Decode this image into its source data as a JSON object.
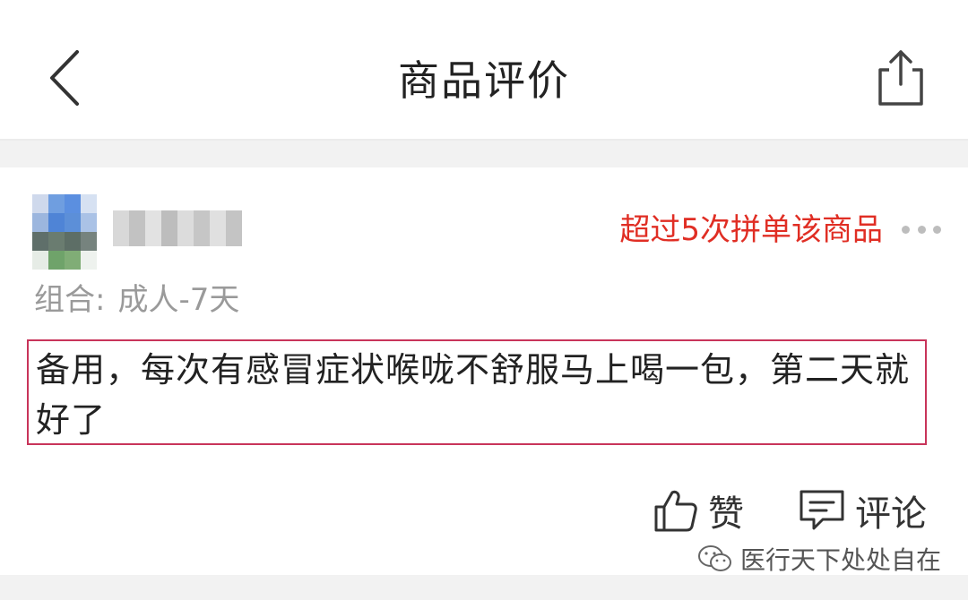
{
  "header": {
    "title": "商品评价",
    "back_icon": "chevron-left-icon",
    "share_icon": "share-icon"
  },
  "review": {
    "purchase_tag": "超过5次拼单该商品",
    "spec_label": "组合:",
    "spec_value": "成人-7天",
    "text": "备用，每次有感冒症状喉咙不舒服马上喝一包，第二天就好了",
    "tag_color": "#e02e24",
    "highlight_color": "#c8345a"
  },
  "actions": {
    "like_label": "赞",
    "comment_label": "评论",
    "like_icon": "thumbs-up-icon",
    "comment_icon": "comment-icon",
    "more_icon": "more-dots-icon"
  },
  "watermark": {
    "text": "医行天下处处自在",
    "icon": "wechat-icon"
  }
}
